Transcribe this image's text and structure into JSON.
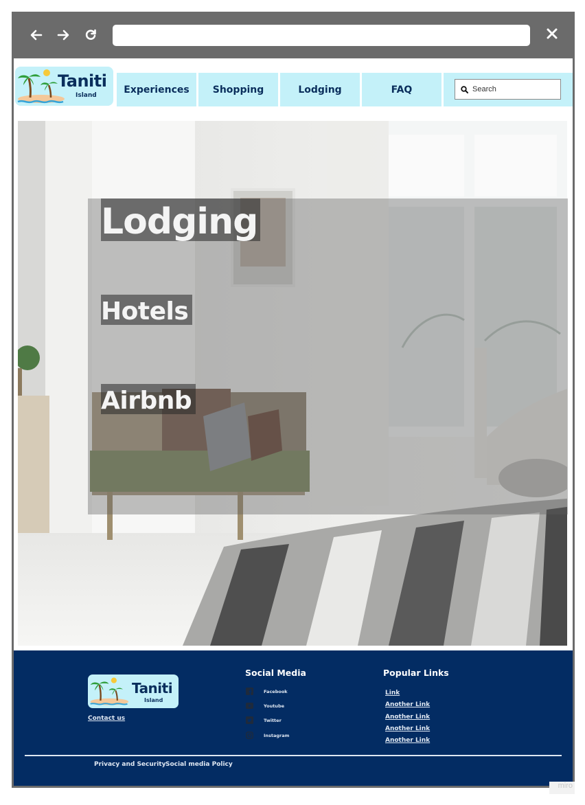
{
  "browser": {
    "back_icon": "arrow-left-icon",
    "forward_icon": "arrow-right-icon",
    "reload_icon": "reload-icon",
    "close_icon": "close-icon",
    "url": ""
  },
  "header": {
    "logo": {
      "name": "Taniti",
      "sub": "Island"
    },
    "nav": [
      "Experiences",
      "Shopping",
      "Lodging",
      "FAQ"
    ],
    "search": {
      "placeholder": "Search",
      "icon": "search-icon"
    }
  },
  "hero": {
    "title": "Lodging",
    "links": [
      "Hotels",
      "Airbnb"
    ]
  },
  "footer": {
    "logo": {
      "name": "Taniti",
      "sub": "Island"
    },
    "contact": "Contact us",
    "social_heading": "Social Media",
    "social": [
      {
        "label": "Facebook",
        "icon": "facebook-icon"
      },
      {
        "label": "Youtube",
        "icon": "youtube-icon"
      },
      {
        "label": "Twitter",
        "icon": "twitter-icon"
      },
      {
        "label": "Instagram",
        "icon": "instagram-icon"
      }
    ],
    "links_heading": "Popular Links",
    "links": [
      "Link",
      "Another Link",
      "Another Link",
      "Another Link",
      "Another Link"
    ],
    "bottom": [
      "Privacy and Security",
      "Social media Policy"
    ]
  },
  "watermark": "miro",
  "colors": {
    "chrome": "#6b6b6b",
    "nav_bg": "#c4f1f9",
    "brand_text": "#0a2e5c",
    "footer_bg": "#032c63"
  }
}
